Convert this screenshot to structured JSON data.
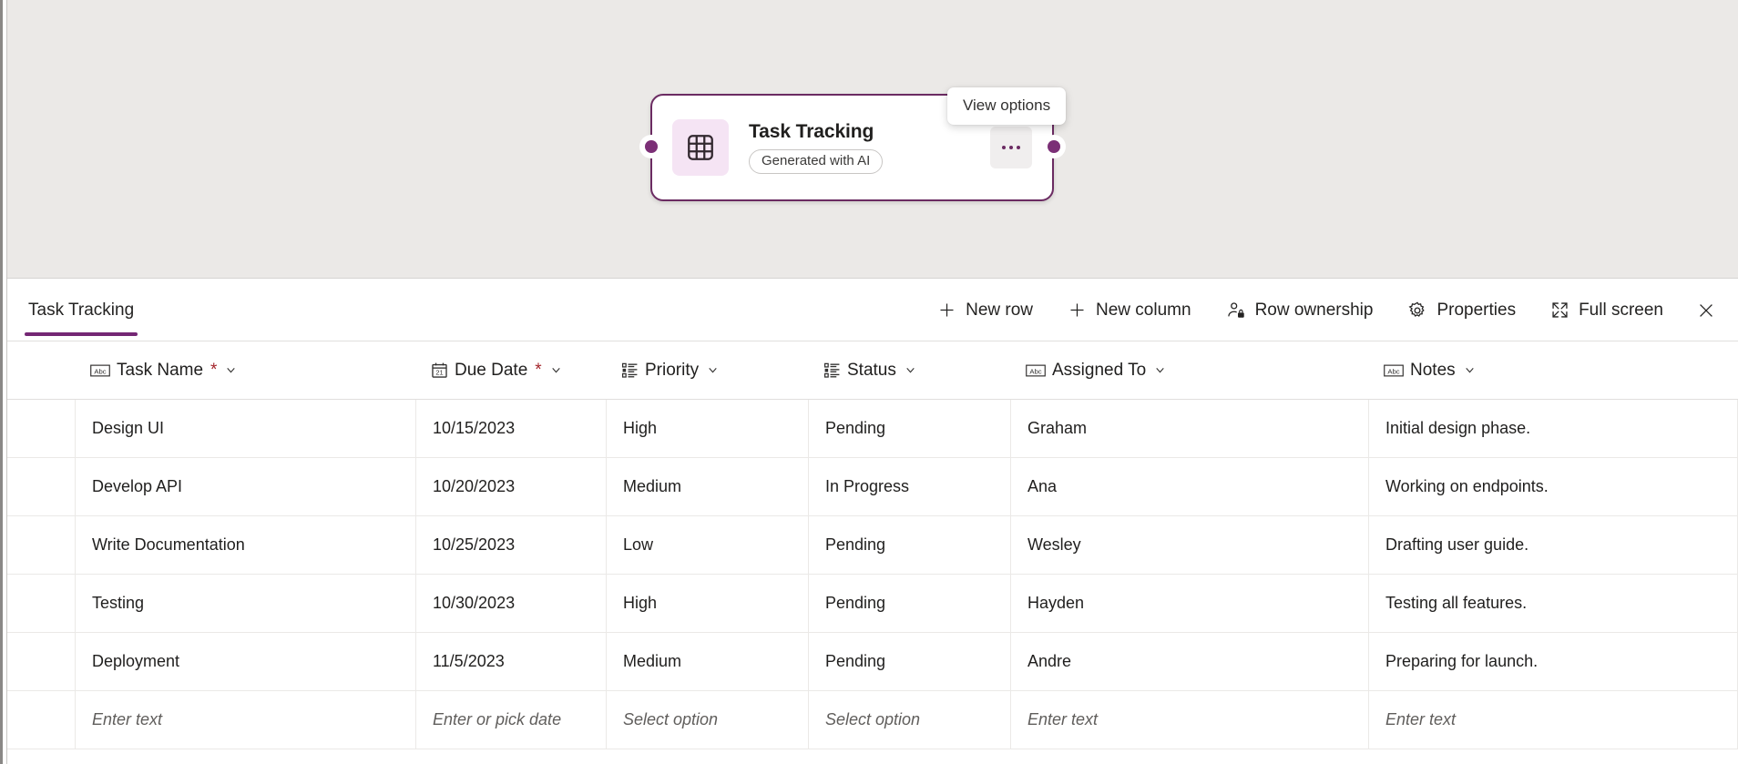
{
  "window": {
    "canvas_bg": "#ebe9e7",
    "accent": "#742774"
  },
  "node": {
    "title": "Task Tracking",
    "badge": "Generated with AI",
    "icon": "table-grid-icon",
    "more_button_label": "…",
    "more_button_name": "view-options-button",
    "tooltip": "View options"
  },
  "toolbar": {
    "tab_label": "Task Tracking",
    "buttons": [
      {
        "label": "New row",
        "icon": "plus-icon"
      },
      {
        "label": "New column",
        "icon": "plus-icon"
      },
      {
        "label": "Row ownership",
        "icon": "person-lock-icon"
      },
      {
        "label": "Properties",
        "icon": "gear-icon"
      },
      {
        "label": "Full screen",
        "icon": "expand-icon"
      }
    ],
    "close_label": "Close"
  },
  "table": {
    "columns": [
      {
        "label": "Task Name",
        "icon": "abc-text-icon",
        "required": true,
        "type": "text"
      },
      {
        "label": "Due Date",
        "icon": "calendar-21-icon",
        "required": true,
        "type": "date"
      },
      {
        "label": "Priority",
        "icon": "choice-list-icon",
        "required": false,
        "type": "choice"
      },
      {
        "label": "Status",
        "icon": "choice-list-icon",
        "required": false,
        "type": "choice"
      },
      {
        "label": "Assigned To",
        "icon": "abc-text-icon",
        "required": false,
        "type": "text"
      },
      {
        "label": "Notes",
        "icon": "abc-text-icon",
        "required": false,
        "type": "text"
      }
    ],
    "required_marker": "*",
    "rows": [
      [
        "Design UI",
        "10/15/2023",
        "High",
        "Pending",
        "Graham",
        "Initial design phase."
      ],
      [
        "Develop API",
        "10/20/2023",
        "Medium",
        "In Progress",
        "Ana",
        "Working on endpoints."
      ],
      [
        "Write Documentation",
        "10/25/2023",
        "Low",
        "Pending",
        "Wesley",
        "Drafting user guide."
      ],
      [
        "Testing",
        "10/30/2023",
        "High",
        "Pending",
        "Hayden",
        "Testing all features."
      ],
      [
        "Deployment",
        "11/5/2023",
        "Medium",
        "Pending",
        "Andre",
        "Preparing for launch."
      ]
    ],
    "new_row_placeholders": [
      "Enter text",
      "Enter or pick date",
      "Select option",
      "Select option",
      "Enter text",
      "Enter text"
    ]
  }
}
